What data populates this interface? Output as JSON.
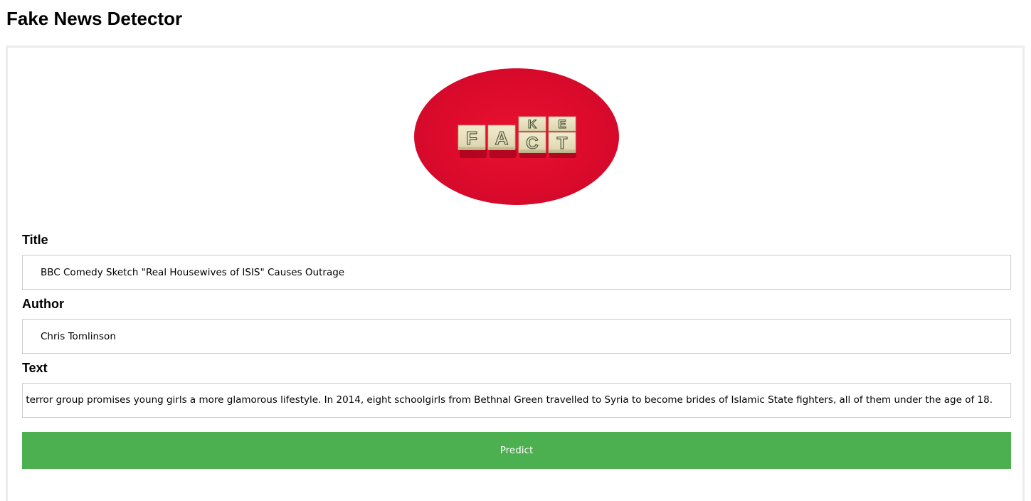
{
  "header": {
    "title": "Fake News Detector"
  },
  "hero_image": {
    "alt": "FAKE FACT",
    "tiles_top_row": [
      "K",
      "E"
    ],
    "tiles_bottom_row": [
      "F",
      "A",
      "C",
      "T"
    ],
    "background_color": "#dc0a2b",
    "tile_color": "#e9e2c2"
  },
  "form": {
    "title_label": "Title",
    "title_value": "BBC Comedy Sketch \"Real Housewives of ISIS\" Causes Outrage",
    "author_label": "Author",
    "author_value": "Chris Tomlinson",
    "text_label": "Text",
    "text_value": "ean countries as the terror group promises young girls a more glamorous lifestyle. In 2014, eight schoolgirls from Bethnal Green travelled to Syria to become brides of Islamic State fighters, all of them under the age of 18.",
    "predict_label": "Predict"
  },
  "colors": {
    "button_background": "#4caf50",
    "button_text": "#ffffff",
    "input_border": "#cccccc",
    "card_border": "#ececec"
  }
}
